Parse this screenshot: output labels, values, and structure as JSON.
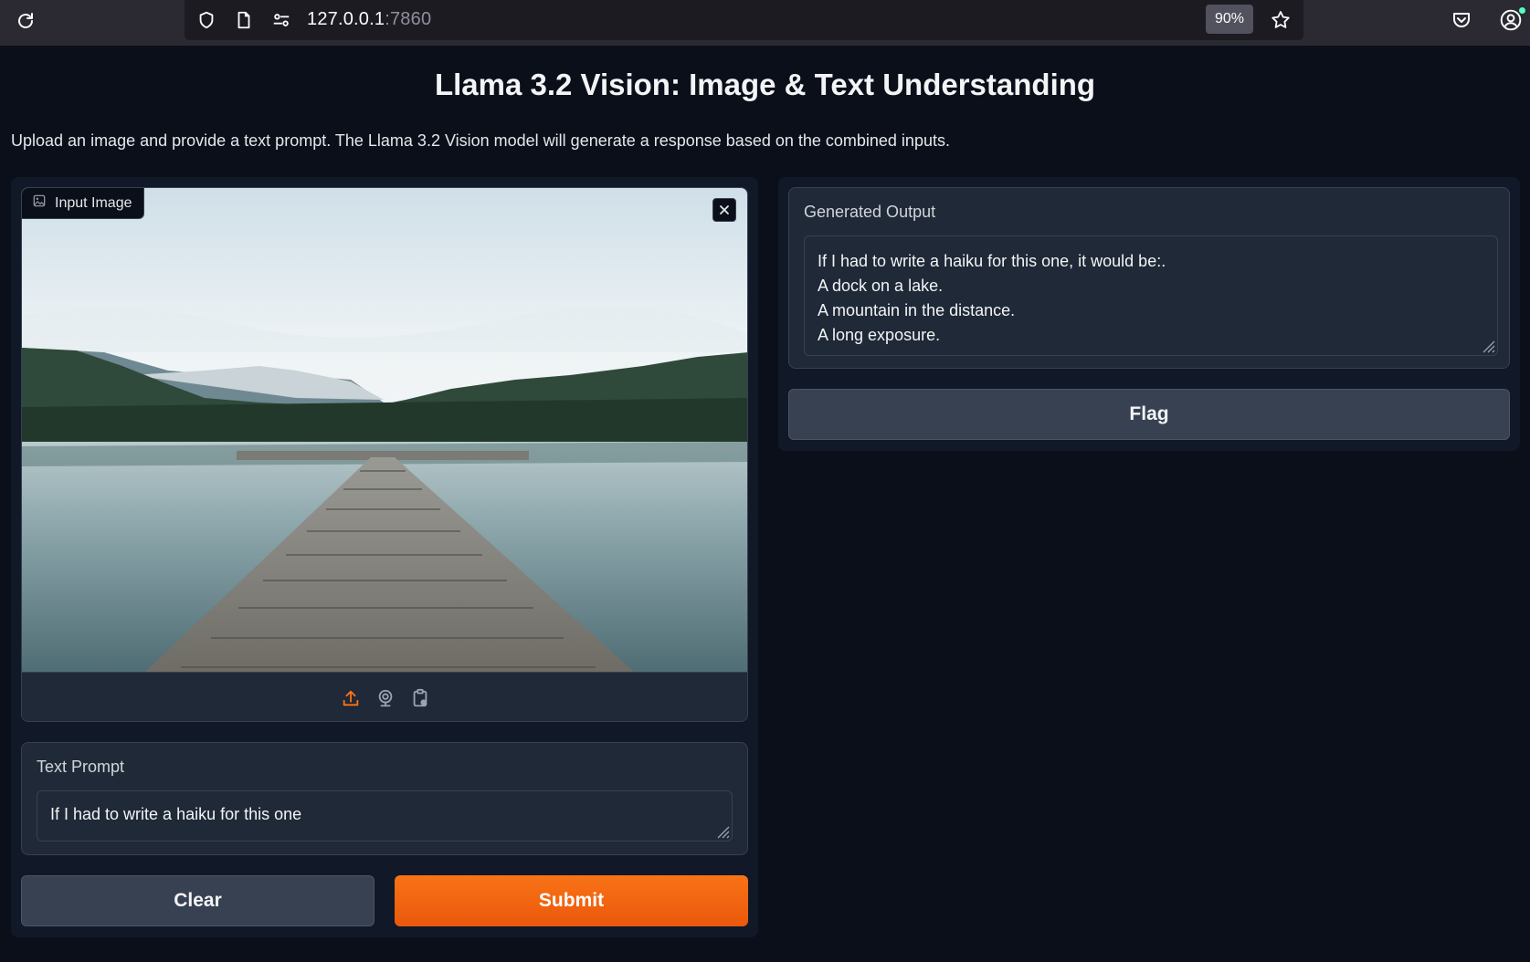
{
  "browser": {
    "url_host": "127.0.0.1",
    "url_port": ":7860",
    "zoom": "90%",
    "icons": [
      "reload-icon",
      "shield-icon",
      "page-icon",
      "permissions-icon",
      "star-icon",
      "pocket-icon",
      "account-icon"
    ]
  },
  "page": {
    "title": "Llama 3.2 Vision: Image & Text Understanding",
    "description": "Upload an image and provide a text prompt. The Llama 3.2 Vision model will generate a response based on the combined inputs."
  },
  "image_input": {
    "label": "Input Image",
    "toolbar_icons": [
      "upload-icon",
      "webcam-icon",
      "clipboard-icon"
    ]
  },
  "text_prompt": {
    "label": "Text Prompt",
    "value": "If I had to write a haiku for this one"
  },
  "buttons": {
    "clear": "Clear",
    "submit": "Submit",
    "flag": "Flag"
  },
  "output": {
    "label": "Generated Output",
    "lines": [
      "If I had to write a haiku for this one, it would be:.",
      "A dock on a lake.",
      "A mountain in the distance.",
      "A long exposure."
    ]
  },
  "colors": {
    "accent": "#f97316",
    "background": "#0b0f19",
    "panel": "#1f2937"
  }
}
